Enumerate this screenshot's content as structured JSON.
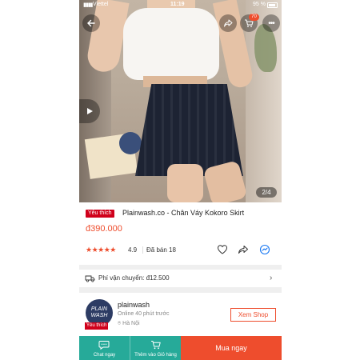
{
  "status_bar": {
    "carrier": "Viettel",
    "time": "11:19",
    "battery": "95 %"
  },
  "header": {
    "cart_count": "70"
  },
  "gallery": {
    "page_indicator": "2/4"
  },
  "product": {
    "badge": "Yêu thích",
    "title": "Plainwash.co - Chân Váy Kokoro Skirt",
    "price": "đ390.000",
    "rating": "4.9",
    "sold": "Đã bán 18",
    "stars": "★★★★★",
    "rating_value": 4.9
  },
  "shipping": {
    "label": "Phí vận chuyển: đ12.500"
  },
  "shop": {
    "logo_text": "PLAIN WASH",
    "badge": "Yêu thích",
    "name": "plainwash",
    "online": "Online 40 phút trước",
    "location": "Hà Nội",
    "view_button": "Xem Shop"
  },
  "bottom_bar": {
    "chat_label": "Chat ngay",
    "cart_label": "Thêm vào Giỏ hàng",
    "buy_label": "Mua ngay"
  },
  "colors": {
    "accent": "#ee4d2d",
    "badge": "#d0011b",
    "teal": "#26aa99"
  }
}
